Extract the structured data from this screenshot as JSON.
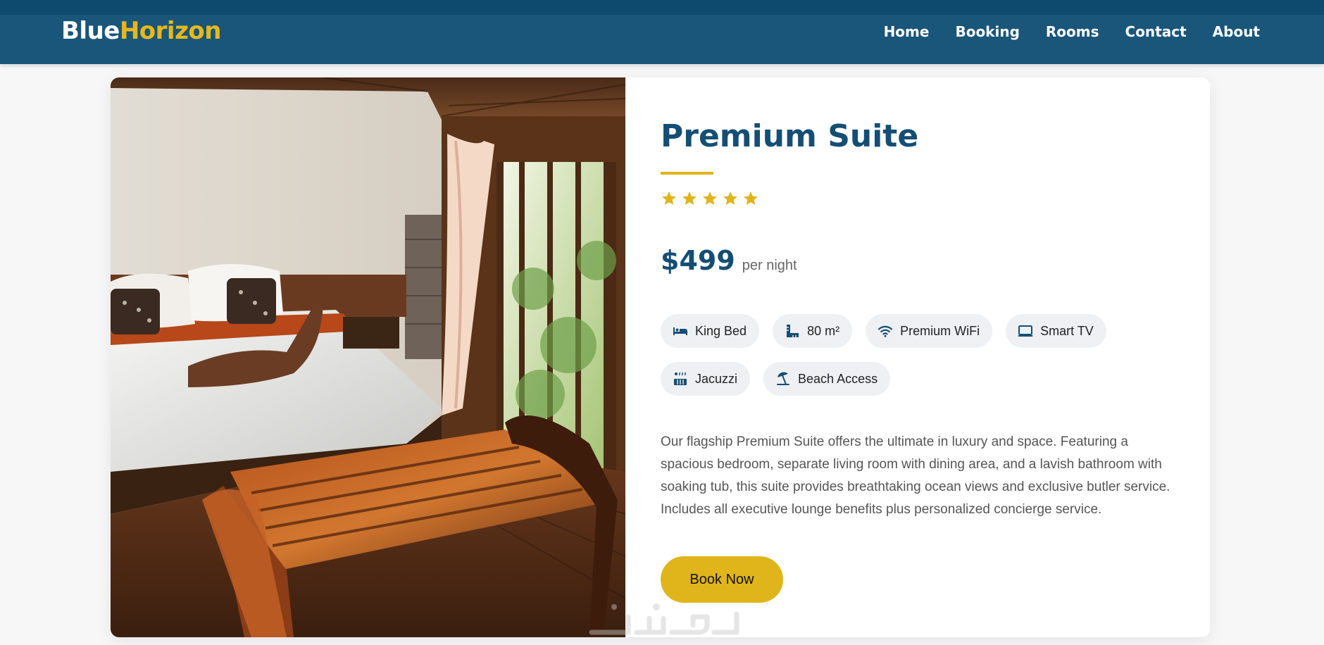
{
  "brand": {
    "part1": "Blue",
    "part2": "Horizon"
  },
  "nav": {
    "items": [
      "Home",
      "Booking",
      "Rooms",
      "Contact",
      "About"
    ]
  },
  "room": {
    "title": "Premium Suite",
    "rating": 5,
    "price": "$499",
    "price_unit": "per night",
    "amenities": [
      {
        "icon": "bed-icon",
        "label": "King Bed"
      },
      {
        "icon": "ruler-icon",
        "label": "80 m²"
      },
      {
        "icon": "wifi-icon",
        "label": "Premium WiFi"
      },
      {
        "icon": "tv-icon",
        "label": "Smart TV"
      },
      {
        "icon": "hot-tub-icon",
        "label": "Jacuzzi"
      },
      {
        "icon": "umbrella-beach-icon",
        "label": "Beach Access"
      }
    ],
    "description": "Our flagship Premium Suite offers the ultimate in luxury and space. Featuring a spacious bedroom, separate living room with dining area, and a lavish bathroom with soaking tub, this suite provides breathtaking ocean views and exclusive butler service. Includes all executive lounge benefits plus personalized concierge service.",
    "cta": "Book Now"
  },
  "colors": {
    "header": "#1a5679",
    "primary": "#154e74",
    "accent": "#dfb51b",
    "chip_bg": "#eef0f3"
  }
}
